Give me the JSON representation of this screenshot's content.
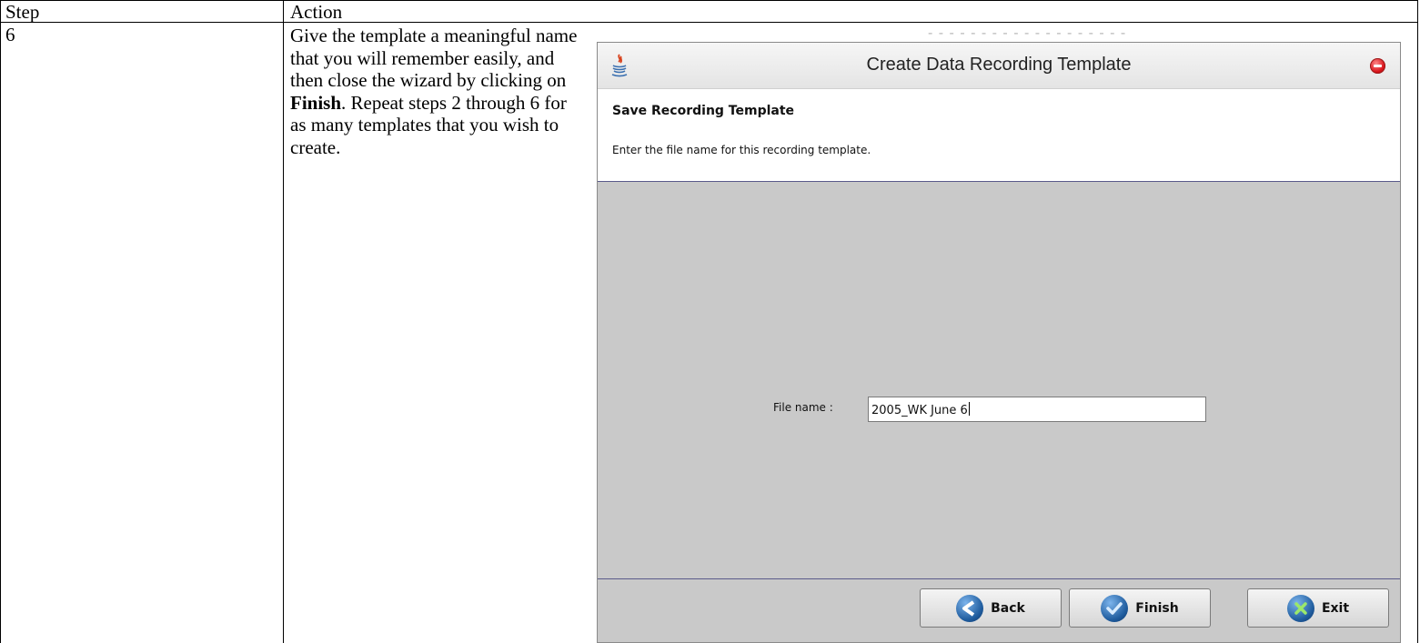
{
  "table": {
    "headers": [
      "Step",
      "Action"
    ],
    "step": "6",
    "instructions": {
      "part1": "Give the template a meaningful name that you will remember easily, and then close the wizard by clicking on ",
      "bold": "Finish",
      "part2": ".  Repeat steps 2 through 6 for as many templates that you wish to create."
    }
  },
  "dialog": {
    "title": "Create Data Recording Template",
    "header_title": "Save Recording Template",
    "header_description": "Enter the file name for this recording template.",
    "file_name_label": "File name :",
    "file_name_value": "2005_WK June 6",
    "buttons": {
      "back": "Back",
      "finish": "Finish",
      "exit": "Exit"
    },
    "icons": {
      "app": "java-icon",
      "close": "close-icon",
      "back": "back-arrow-icon",
      "finish": "checkmark-icon",
      "exit": "x-icon"
    }
  }
}
